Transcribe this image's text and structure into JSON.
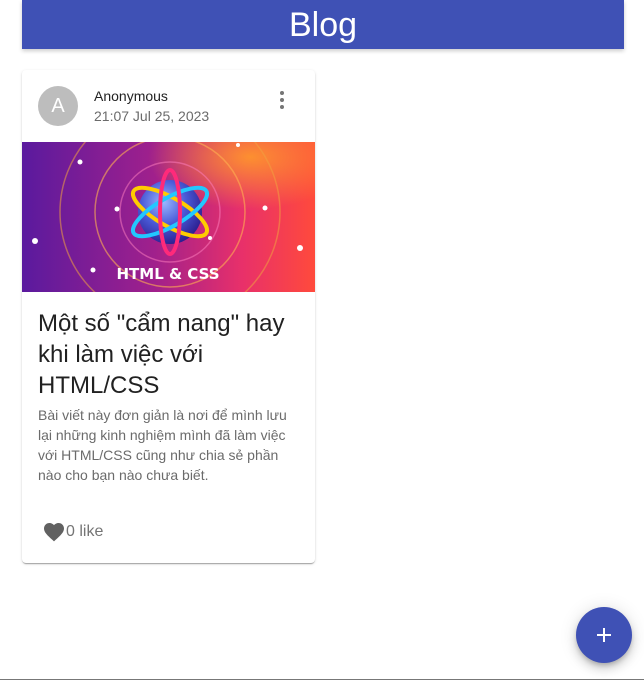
{
  "app": {
    "title": "Blog"
  },
  "post": {
    "avatar_letter": "A",
    "author": "Anonymous",
    "date": "21:07 Jul 25, 2023",
    "image_text": "HTML & CSS",
    "title": "Một số \"cẩm nang\" hay khi làm việc với HTML/CSS",
    "excerpt": "Bài viết này đơn giản là nơi để mình lưu lại những kinh nghiệm mình đã làm việc với HTML/CSS cũng như chia sẻ phần nào cho bạn nào chưa biết.",
    "like_label": "0 like"
  },
  "icons": {
    "more": "more-vert-icon",
    "like": "heart-icon",
    "add": "add-icon"
  },
  "colors": {
    "primary": "#3f51b5",
    "avatar_bg": "#bdbdbd"
  }
}
